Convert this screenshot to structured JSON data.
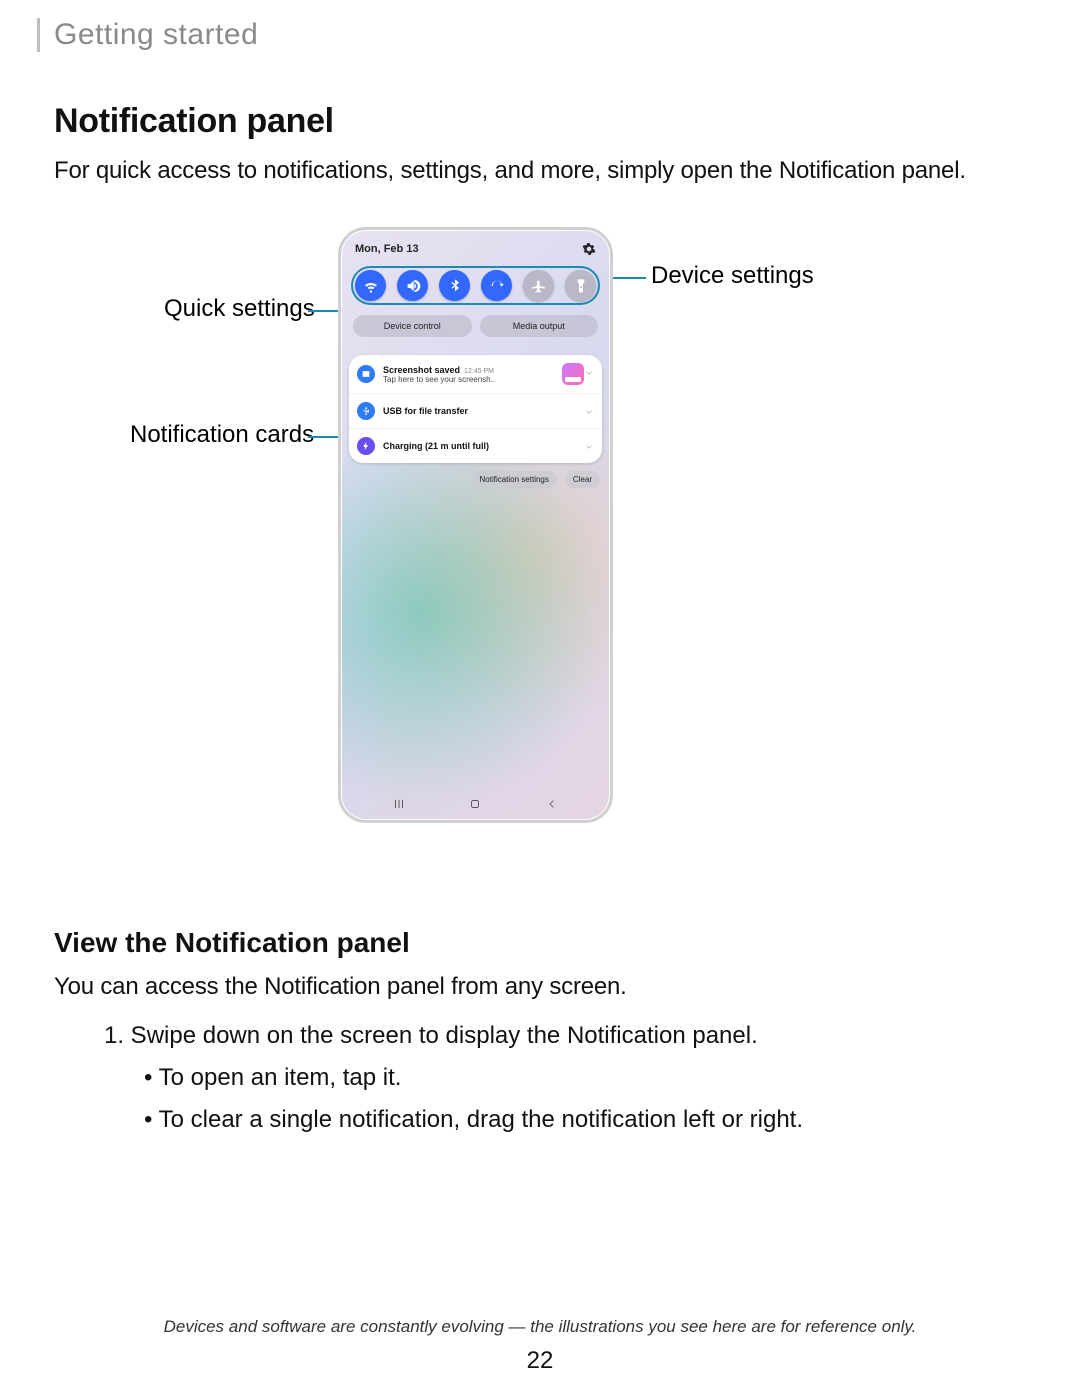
{
  "doc": {
    "chapter": "Getting started",
    "h1": "Notification panel",
    "intro": "For quick access to notifications, settings, and more, simply open the Notification panel.",
    "h2": "View the Notification panel",
    "h2_body": "You can access the Notification panel from any screen.",
    "step1": "1.  Swipe down on the screen to display the Notification panel.",
    "bullet1": "To open an item, tap it.",
    "bullet2": "To clear a single notification, drag the notification left or right.",
    "footnote": "Devices and software are constantly evolving — the illustrations you see here are for reference only.",
    "page": "22"
  },
  "callouts": {
    "quick_settings": "Quick settings",
    "notification_cards": "Notification cards",
    "device_settings": "Device settings"
  },
  "phone": {
    "date": "Mon, Feb 13",
    "chips": {
      "device_control": "Device control",
      "media_output": "Media output"
    },
    "cards": [
      {
        "icon": "image",
        "title": "Screenshot saved",
        "time": "12:45 PM",
        "sub": "Tap here to see your screensh..",
        "thumb": true
      },
      {
        "icon": "usb",
        "title": "USB for file transfer"
      },
      {
        "icon": "bolt",
        "title": "Charging (21 m until full)"
      }
    ],
    "actions": {
      "settings": "Notification settings",
      "clear": "Clear"
    }
  }
}
